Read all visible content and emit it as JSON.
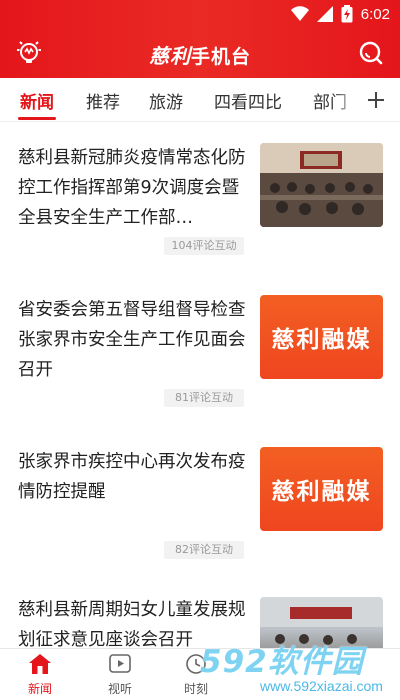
{
  "status_bar": {
    "time": "6:02"
  },
  "header": {
    "brand": "慈利",
    "title_suffix": "手机台"
  },
  "tabs": [
    {
      "label": "新闻",
      "active": true
    },
    {
      "label": "推荐"
    },
    {
      "label": "旅游"
    },
    {
      "label": "四看四比"
    },
    {
      "label": "部门"
    }
  ],
  "news": [
    {
      "headline": "慈利县新冠肺炎疫情常态化防控工作指挥部第9次调度会暨全县安全生产工作部…",
      "comments": "104评论互动",
      "thumb": "meeting-photo"
    },
    {
      "headline": "省安委会第五督导组督导检查张家界市安全生产工作见面会召开",
      "comments": "81评论互动",
      "thumb": "brand-card",
      "thumb_text": "慈利融媒"
    },
    {
      "headline": "张家界市疾控中心再次发布疫情防控提醒",
      "comments": "82评论互动",
      "thumb": "brand-card",
      "thumb_text": "慈利融媒"
    },
    {
      "headline": "慈利县新周期妇女儿童发展规划征求意见座谈会召开",
      "comments": "",
      "thumb": "meeting-photo-2"
    }
  ],
  "bottom_nav": [
    {
      "label": "新闻",
      "icon": "home-icon",
      "active": true
    },
    {
      "label": "视听",
      "icon": "play-icon"
    },
    {
      "label": "时刻",
      "icon": "clock-icon"
    }
  ],
  "watermark": {
    "brand": "592软件园",
    "url": "www.592xiazai.com"
  },
  "colors": {
    "accent": "#e4161b",
    "brand_card": "#f25f22"
  }
}
